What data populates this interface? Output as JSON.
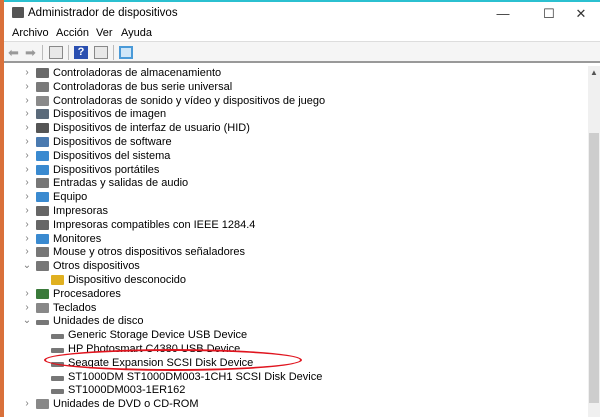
{
  "window": {
    "title": "Administrador de dispositivos",
    "minimize": "—",
    "maximize": "☐",
    "close": "✕"
  },
  "menu": [
    "Archivo",
    "Acción",
    "Ver",
    "Ayuda"
  ],
  "tree": [
    {
      "label": "Controladoras de almacenamiento",
      "level": 0,
      "state": "collapsed",
      "icon": "storage-controller-icon",
      "color": "#6a6a6a"
    },
    {
      "label": "Controladoras de bus serie universal",
      "level": 0,
      "state": "collapsed",
      "icon": "usb-icon",
      "color": "#7a7a7a"
    },
    {
      "label": "Controladoras de sonido y vídeo y dispositivos de juego",
      "level": 0,
      "state": "collapsed",
      "icon": "speaker-icon",
      "color": "#8a8a8a"
    },
    {
      "label": "Dispositivos de imagen",
      "level": 0,
      "state": "collapsed",
      "icon": "camera-icon",
      "color": "#5a6a7a"
    },
    {
      "label": "Dispositivos de interfaz de usuario (HID)",
      "level": 0,
      "state": "collapsed",
      "icon": "hid-icon",
      "color": "#555"
    },
    {
      "label": "Dispositivos de software",
      "level": 0,
      "state": "collapsed",
      "icon": "software-device-icon",
      "color": "#4a7ab0"
    },
    {
      "label": "Dispositivos del sistema",
      "level": 0,
      "state": "collapsed",
      "icon": "system-device-icon",
      "color": "#3a8ad0"
    },
    {
      "label": "Dispositivos portátiles",
      "level": 0,
      "state": "collapsed",
      "icon": "portable-device-icon",
      "color": "#3a8ad0"
    },
    {
      "label": "Entradas y salidas de audio",
      "level": 0,
      "state": "collapsed",
      "icon": "audio-icon",
      "color": "#777"
    },
    {
      "label": "Equipo",
      "level": 0,
      "state": "collapsed",
      "icon": "computer-icon",
      "color": "#3a8ad0"
    },
    {
      "label": "Impresoras",
      "level": 0,
      "state": "collapsed",
      "icon": "printer-icon",
      "color": "#666"
    },
    {
      "label": "Impresoras compatibles con IEEE 1284.4",
      "level": 0,
      "state": "collapsed",
      "icon": "printer-icon",
      "color": "#666"
    },
    {
      "label": "Monitores",
      "level": 0,
      "state": "collapsed",
      "icon": "monitor-icon",
      "color": "#3a8ad0"
    },
    {
      "label": "Mouse y otros dispositivos señaladores",
      "level": 0,
      "state": "collapsed",
      "icon": "mouse-icon",
      "color": "#777"
    },
    {
      "label": "Otros dispositivos",
      "level": 0,
      "state": "expanded",
      "icon": "unknown-device-icon",
      "color": "#777"
    },
    {
      "label": "Dispositivo desconocido",
      "level": 1,
      "state": "leaf",
      "icon": "warning-icon",
      "color": "#e0b020"
    },
    {
      "label": "Procesadores",
      "level": 0,
      "state": "collapsed",
      "icon": "processor-icon",
      "color": "#3a7a3a"
    },
    {
      "label": "Teclados",
      "level": 0,
      "state": "collapsed",
      "icon": "keyboard-icon",
      "color": "#888"
    },
    {
      "label": "Unidades de disco",
      "level": 0,
      "state": "expanded",
      "icon": "disk-drive-icon",
      "color": "#777"
    },
    {
      "label": "Generic Storage Device USB Device",
      "level": 1,
      "state": "leaf",
      "icon": "disk-drive-icon",
      "color": "#777"
    },
    {
      "label": "HP Photosmart C4380 USB Device",
      "level": 1,
      "state": "leaf",
      "icon": "disk-drive-icon",
      "color": "#777"
    },
    {
      "label": "Seagate Expansion SCSI Disk Device",
      "level": 1,
      "state": "leaf",
      "icon": "disk-drive-icon",
      "color": "#777"
    },
    {
      "label": "ST1000DM ST1000DM003-1CH1 SCSI Disk Device",
      "level": 1,
      "state": "leaf",
      "icon": "disk-drive-icon",
      "color": "#777"
    },
    {
      "label": "ST1000DM003-1ER162",
      "level": 1,
      "state": "leaf",
      "icon": "disk-drive-icon",
      "color": "#777"
    },
    {
      "label": "Unidades de DVD o CD-ROM",
      "level": 0,
      "state": "collapsed",
      "icon": "dvd-drive-icon",
      "color": "#888"
    }
  ],
  "highlight_color": "#e0141e"
}
